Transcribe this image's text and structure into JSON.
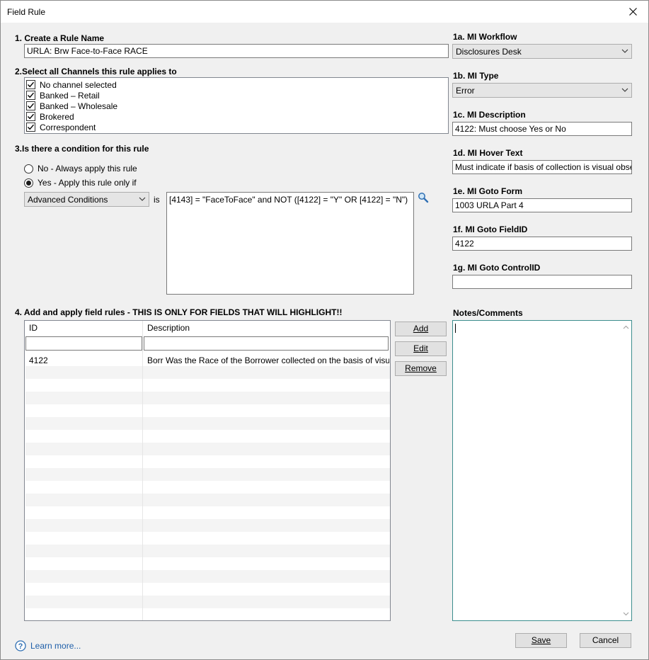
{
  "window": {
    "title": "Field Rule"
  },
  "section1": {
    "label": "1. Create a Rule Name",
    "value": "URLA: Brw Face-to-Face RACE"
  },
  "section2": {
    "label": "2.Select all Channels this rule applies to",
    "channels": [
      {
        "label": "No channel selected",
        "checked": true
      },
      {
        "label": "Banked – Retail",
        "checked": true
      },
      {
        "label": "Banked – Wholesale",
        "checked": true
      },
      {
        "label": "Brokered",
        "checked": true
      },
      {
        "label": "Correspondent",
        "checked": true
      }
    ]
  },
  "section3": {
    "label": "3.Is there a condition for this rule",
    "radio_no": "No - Always apply this rule",
    "radio_yes": "Yes - Apply this rule only if",
    "condition_type": "Advanced Conditions",
    "is_label": "is",
    "condition_text": "[4143] = \"FaceToFace\" and NOT ([4122] = \"Y\" OR [4122] = \"N\")"
  },
  "right": {
    "workflow_label": "1a. MI Workflow",
    "workflow_value": "Disclosures Desk",
    "type_label": "1b. MI Type",
    "type_value": "Error",
    "description_label": "1c. MI Description",
    "description_value": "4122: Must choose Yes or No",
    "hover_label": "1d. MI Hover Text",
    "hover_value": "Must indicate if basis of collection is visual observatio",
    "goto_form_label": "1e. MI Goto Form",
    "goto_form_value": "1003 URLA Part 4",
    "goto_field_label": "1f. MI Goto FieldID",
    "goto_field_value": "4122",
    "goto_control_label": "1g. MI Goto ControlID",
    "goto_control_value": "",
    "notes_label": "Notes/Comments"
  },
  "section4": {
    "label": "4. Add and apply field rules - THIS IS ONLY FOR FIELDS THAT WILL HIGHLIGHT!!",
    "columns": [
      "ID",
      "Description"
    ],
    "rows": [
      {
        "id": "4122",
        "description": "Borr Was the Race of the Borrower collected on the basis of visual obse"
      }
    ],
    "add_button": "Add",
    "edit_button": "Edit",
    "remove_button": "Remove"
  },
  "footer": {
    "learn_more": "Learn more...",
    "save": "Save",
    "cancel": "Cancel"
  }
}
